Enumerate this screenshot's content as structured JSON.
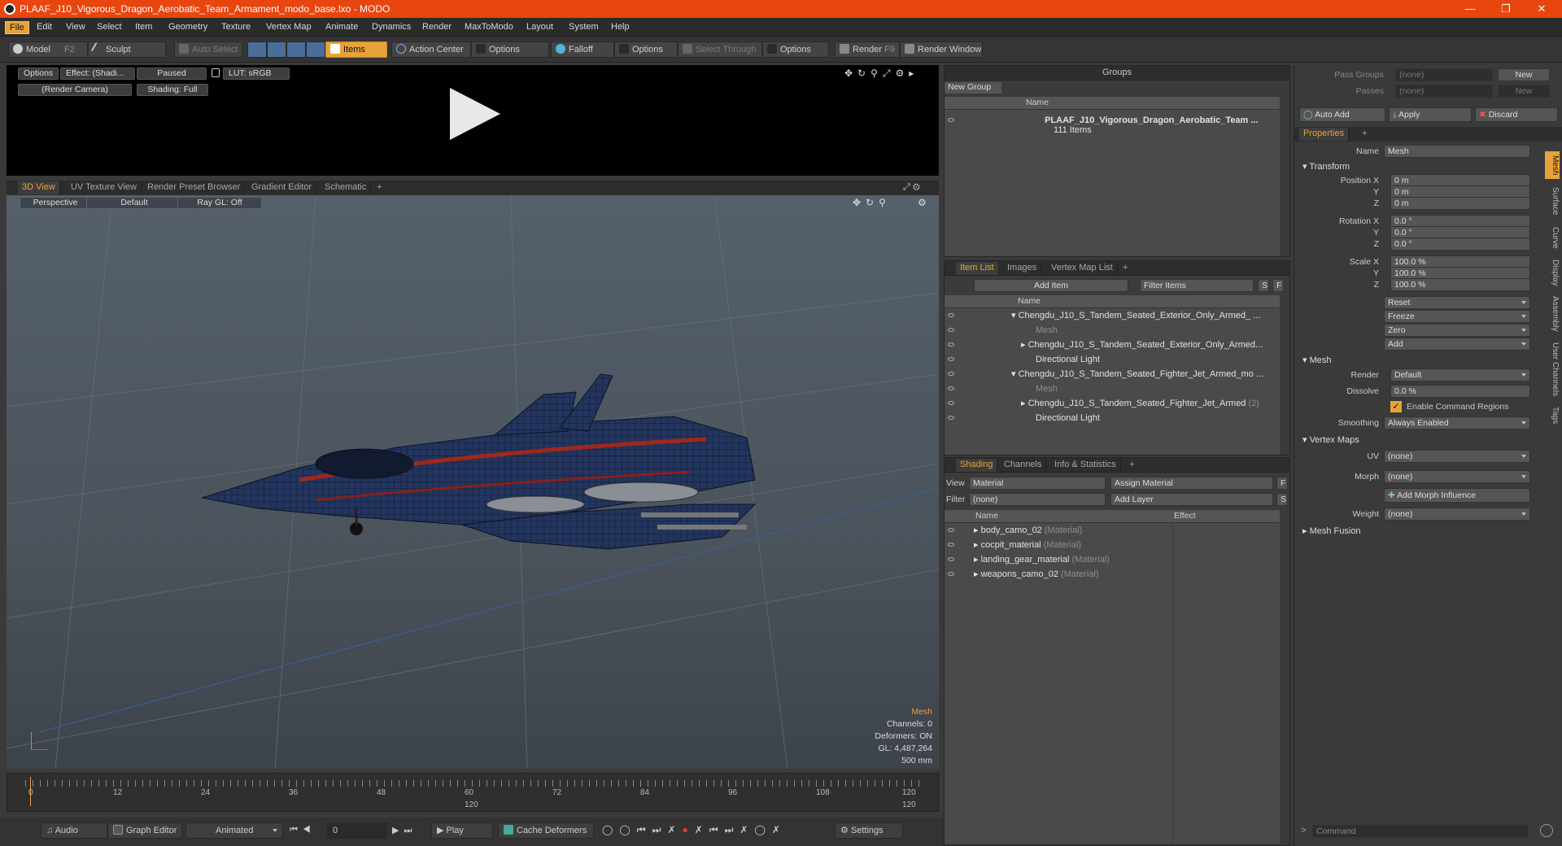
{
  "title": "PLAAF_J10_Vigorous_Dragon_Aerobatic_Team_Armament_modo_base.lxo - MODO",
  "menus": [
    "File",
    "Edit",
    "View",
    "Select",
    "Item",
    "Geometry",
    "Texture",
    "Vertex Map",
    "Animate",
    "Dynamics",
    "Render",
    "MaxToModo",
    "Layout",
    "System",
    "Help"
  ],
  "toolbar": {
    "model": "Model",
    "model_key": "F2",
    "sculpt": "Sculpt",
    "auto_select": "Auto Select",
    "items": "Items",
    "action_center": "Action Center",
    "options1": "Options",
    "falloff": "Falloff",
    "options2": "Options",
    "select_through": "Select Through",
    "options3": "Options",
    "render": "Render",
    "render_key": "F9",
    "render_window": "Render Window"
  },
  "preview": {
    "options": "Options",
    "effect": "Effect: (Shadi...",
    "paused": "Paused",
    "lut": "LUT: sRGB",
    "camera": "(Render Camera)",
    "shading": "Shading: Full"
  },
  "viewport_tabs": [
    "3D View",
    "UV Texture View",
    "Render Preset Browser",
    "Gradient Editor",
    "Schematic",
    "+"
  ],
  "viewport": {
    "perspective": "Perspective",
    "default": "Default",
    "raygl": "Ray GL: Off",
    "info": {
      "mesh": "Mesh",
      "channels": "Channels: 0",
      "deformers": "Deformers: ON",
      "gl": "GL: 4,487,264",
      "scale": "500 mm"
    }
  },
  "timeline": {
    "ticks": [
      "0",
      "12",
      "24",
      "36",
      "48",
      "60",
      "72",
      "84",
      "96",
      "108",
      "120"
    ],
    "sub_mid": "120",
    "sub_end": "120"
  },
  "bottom": {
    "audio": "Audio",
    "graph_editor": "Graph Editor",
    "animated": "Animated",
    "frame": "0",
    "play": "Play",
    "cache": "Cache Deformers",
    "settings": "Settings"
  },
  "groups": {
    "title": "Groups",
    "new_group": "New Group",
    "col_name": "Name",
    "item_name": "PLAAF_J10_Vigorous_Dragon_Aerobatic_Team ...",
    "item_count": "111 Items"
  },
  "itemlist": {
    "tabs": [
      "Item List",
      "Images",
      "Vertex Map List",
      "+"
    ],
    "add_item": "Add Item",
    "filter": "Filter Items",
    "s": "S",
    "f": "F",
    "col_name": "Name",
    "rows": [
      {
        "text": "Chengdu_J10_S_Tandem_Seated_Exterior_Only_Armed_ ...",
        "muted": false
      },
      {
        "text": "Mesh",
        "muted": true
      },
      {
        "text": "Chengdu_J10_S_Tandem_Seated_Exterior_Only_Armed...",
        "muted": false
      },
      {
        "text": "Directional Light",
        "muted": false
      },
      {
        "text": "Chengdu_J10_S_Tandem_Seated_Fighter_Jet_Armed_mo ...",
        "muted": false
      },
      {
        "text": "Mesh",
        "muted": true
      },
      {
        "text": "Chengdu_J10_S_Tandem_Seated_Fighter_Jet_Armed",
        "muted": false,
        "suffix": "(2)"
      },
      {
        "text": "Directional Light",
        "muted": false
      }
    ]
  },
  "shading": {
    "tabs": [
      "Shading",
      "Channels",
      "Info & Statistics",
      "+"
    ],
    "view_label": "View",
    "view_value": "Material",
    "assign": "Assign Material",
    "f": "F",
    "filter_label": "Filter",
    "filter_value": "(none)",
    "add_layer": "Add Layer",
    "s": "S",
    "col_name": "Name",
    "col_effect": "Effect",
    "rows": [
      {
        "name": "body_camo_02",
        "type": "(Material)"
      },
      {
        "name": "cocpit_material",
        "type": "(Material)"
      },
      {
        "name": "landing_gear_material",
        "type": "(Material)"
      },
      {
        "name": "weapons_camo_02",
        "type": "(Material)"
      }
    ]
  },
  "props": {
    "pass_groups": "Pass Groups",
    "passes": "Passes",
    "none": "(none)",
    "new": "New",
    "auto_add": "Auto Add",
    "apply": "Apply",
    "discard": "Discard",
    "tab": "Properties",
    "plus": "+",
    "name_label": "Name",
    "name_value": "Mesh",
    "transform": "Transform",
    "pos_label": "Position X",
    "pos_x": "0 m",
    "pos_y": "0 m",
    "pos_z": "0 m",
    "rot_label": "Rotation X",
    "rot_x": "0.0 °",
    "rot_y": "0.0 °",
    "rot_z": "0.0 °",
    "scale_label": "Scale X",
    "scale_x": "100.0 %",
    "scale_y": "100.0 %",
    "scale_z": "100.0 %",
    "y": "Y",
    "z": "Z",
    "reset": "Reset",
    "freeze": "Freeze",
    "zero": "Zero",
    "add": "Add",
    "mesh": "Mesh",
    "render_label": "Render",
    "render_value": "Default",
    "dissolve_label": "Dissolve",
    "dissolve_value": "0.0 %",
    "enable_cmd": "Enable Command Regions",
    "smoothing_label": "Smoothing",
    "smoothing_value": "Always Enabled",
    "vertex_maps": "Vertex Maps",
    "uv_label": "UV",
    "uv_value": "(none)",
    "morph_label": "Morph",
    "morph_value": "(none)",
    "add_morph": "Add Morph Influence",
    "weight_label": "Weight",
    "weight_value": "(none)",
    "mesh_fusion": "Mesh Fusion",
    "side_tabs": [
      "Mesh",
      "Surface",
      "Curve",
      "Display",
      "Assembly",
      "User Channels",
      "Tags"
    ],
    "command": "Command"
  },
  "colors": {
    "accent": "#e8a23a",
    "titlebar": "#e8450f"
  }
}
